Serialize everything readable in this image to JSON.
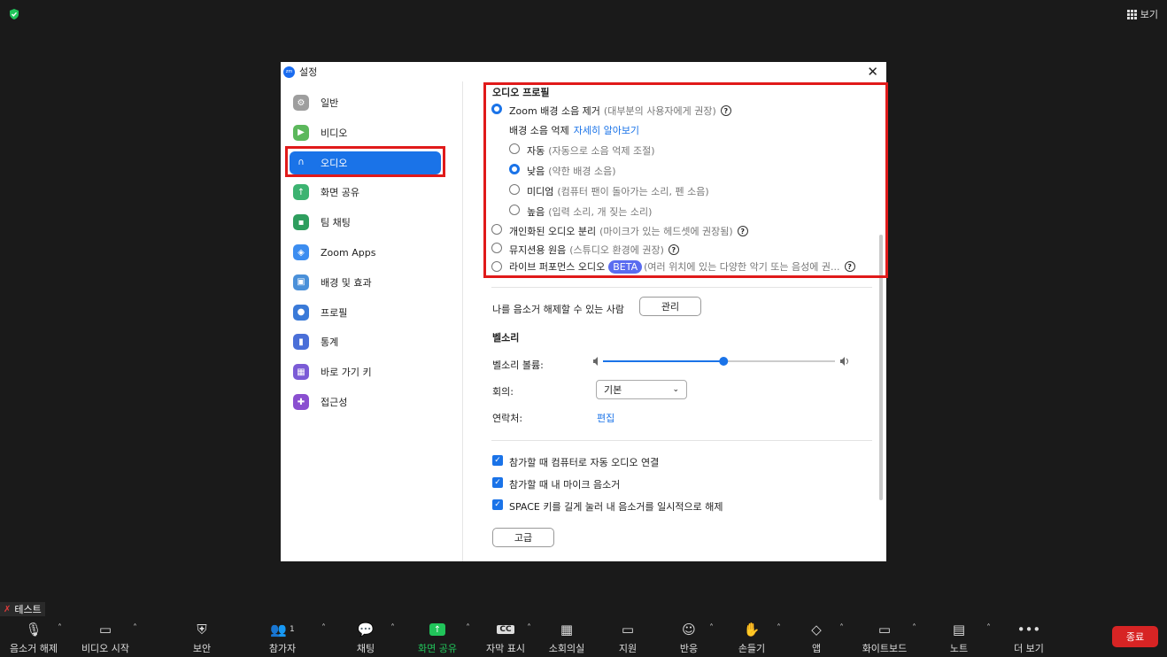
{
  "top_bar": {
    "view_label": "보기"
  },
  "dialog": {
    "title": "설정",
    "logo_text": "zm",
    "close": "✕",
    "sidebar": [
      {
        "label": "일반",
        "icon": "gear-icon",
        "color": "#9e9e9e"
      },
      {
        "label": "비디오",
        "icon": "video-icon",
        "color": "#5cb85c"
      },
      {
        "label": "오디오",
        "icon": "headphones-icon",
        "color": "#1a73e8"
      },
      {
        "label": "화면 공유",
        "icon": "share-screen-icon",
        "color": "#3cb371"
      },
      {
        "label": "팀 채팅",
        "icon": "chat-icon",
        "color": "#2e9e5e"
      },
      {
        "label": "Zoom Apps",
        "icon": "apps-icon",
        "color": "#3c8df0"
      },
      {
        "label": "배경 및 효과",
        "icon": "background-icon",
        "color": "#4a90d9"
      },
      {
        "label": "프로필",
        "icon": "profile-icon",
        "color": "#3a7ad8"
      },
      {
        "label": "통계",
        "icon": "stats-icon",
        "color": "#4a6fd8"
      },
      {
        "label": "바로 가기 키",
        "icon": "keyboard-icon",
        "color": "#7b5bd6"
      },
      {
        "label": "접근성",
        "icon": "accessibility-icon",
        "color": "#8a4fd0"
      }
    ],
    "audio_profile": {
      "heading": "오디오 프로필",
      "zoom_bg": {
        "label": "Zoom 배경 소음 제거",
        "note": "(대부분의 사용자에게 권장)"
      },
      "suppress_label": "배경 소음 억제",
      "learn_more": "자세히 알아보기",
      "levels": [
        {
          "label": "자동",
          "note": "(자동으로 소음 억제 조절)",
          "selected": false
        },
        {
          "label": "낮음",
          "note": "(약한 배경 소음)",
          "selected": true
        },
        {
          "label": "미디엄",
          "note": "(컴퓨터 팬이 돌아가는 소리, 펜 소음)",
          "selected": false
        },
        {
          "label": "높음",
          "note": "(입력 소리, 개 짖는 소리)",
          "selected": false
        }
      ],
      "personal": {
        "label": "개인화된 오디오 분리",
        "note": "(마이크가 있는 헤드셋에 권장됨)"
      },
      "music": {
        "label": "뮤지션용 원음",
        "note": "(스튜디오 환경에 권장)"
      },
      "live": {
        "label": "라이브 퍼포먼스 오디오",
        "badge": "BETA",
        "note": "(여러 위치에 있는 다양한 악기 또는 음성에 권..."
      }
    },
    "unmute_label": "나를 음소거 해제할 수 있는 사람",
    "manage_button": "관리",
    "ringtone_heading": "벨소리",
    "ringtone_volume_label": "벨소리 볼륨:",
    "ringtone_volume": 0.52,
    "meeting_label": "회의:",
    "meeting_value": "기본",
    "contact_label": "연락처:",
    "contact_edit": "편집",
    "checkboxes": [
      "참가할 때 컴퓨터로 자동 오디오 연결",
      "참가할 때 내 마이크 음소거",
      "SPACE 키를 길게 눌러 내 음소거를 일시적으로 해제"
    ],
    "advanced_button": "고급"
  },
  "toolbar": {
    "test_label": "테스트",
    "items": [
      {
        "label": "음소거 해제",
        "icon": "mic-muted-icon"
      },
      {
        "label": "비디오 시작",
        "icon": "video-off-icon"
      },
      {
        "label": "보안",
        "icon": "shield-icon"
      },
      {
        "label": "참가자",
        "icon": "participants-icon",
        "count": "1"
      },
      {
        "label": "채팅",
        "icon": "chat-icon"
      },
      {
        "label": "화면 공유",
        "icon": "share-screen-icon"
      },
      {
        "label": "자막 표시",
        "icon": "cc-icon",
        "glyph": "CC"
      },
      {
        "label": "소회의실",
        "icon": "breakout-icon"
      },
      {
        "label": "지원",
        "icon": "cast-icon"
      },
      {
        "label": "반응",
        "icon": "reaction-icon"
      },
      {
        "label": "손들기",
        "icon": "hand-icon"
      },
      {
        "label": "앱",
        "icon": "apps-icon"
      },
      {
        "label": "화이트보드",
        "icon": "whiteboard-icon"
      },
      {
        "label": "노트",
        "icon": "notes-icon"
      },
      {
        "label": "더 보기",
        "icon": "more-icon"
      }
    ],
    "end_label": "종료",
    "colors": {
      "share_green": "#21c45a",
      "end_red": "#d72424"
    }
  }
}
